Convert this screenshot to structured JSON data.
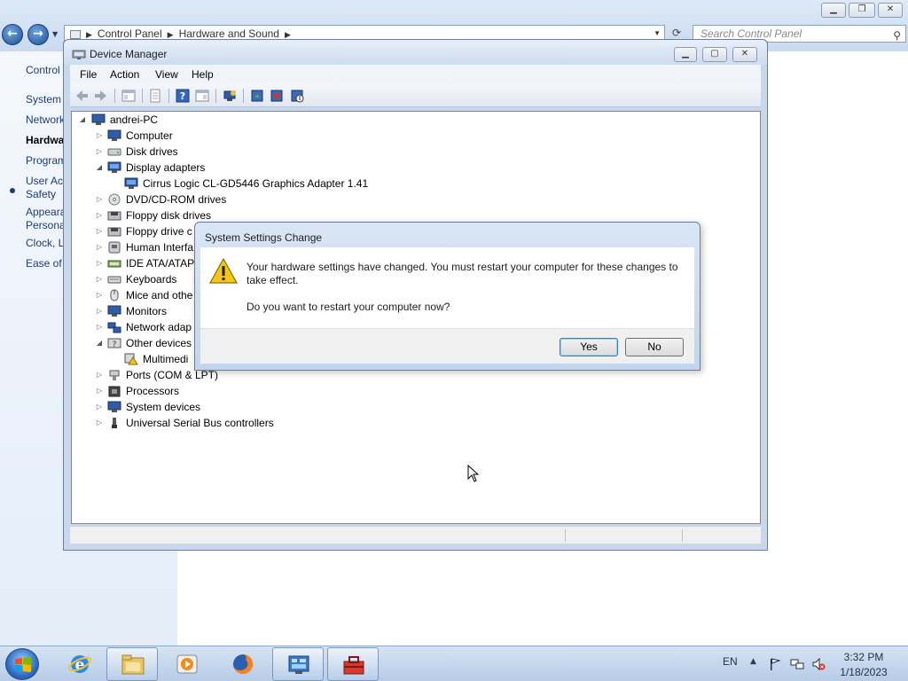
{
  "control_panel": {
    "breadcrumb": [
      "Control Panel",
      "Hardware and Sound"
    ],
    "search_placeholder": "Search Control Panel",
    "sidebar": [
      "Control",
      "System",
      "Network",
      "Hardwa",
      "Program",
      "User Ac",
      "Safety",
      "Appeara",
      "Persona",
      "Clock, L",
      "Ease of A"
    ]
  },
  "device_manager": {
    "title": "Device Manager",
    "menu": [
      "File",
      "Action",
      "View",
      "Help"
    ],
    "tree": {
      "root": "andrei-PC",
      "items": [
        "Computer",
        "Disk drives",
        "Display adapters",
        "Cirrus Logic CL-GD5446 Graphics Adapter 1.41",
        "DVD/CD-ROM drives",
        "Floppy disk drives",
        "Floppy drive c",
        "Human Interfa",
        "IDE ATA/ATAP",
        "Keyboards",
        "Mice and othe",
        "Monitors",
        "Network adap",
        "Other devices",
        "Multimedi",
        "Ports (COM & LPT)",
        "Processors",
        "System devices",
        "Universal Serial Bus controllers"
      ]
    }
  },
  "dialog": {
    "title": "System Settings Change",
    "message_line1": "Your hardware settings have changed. You must restart your computer for these changes to",
    "message_line2": "take effect.",
    "question": "Do you want to restart your computer now?",
    "yes_label": "Yes",
    "no_label": "No"
  },
  "taskbar": {
    "language": "EN",
    "time": "3:32 PM",
    "date": "1/18/2023"
  },
  "colors": {
    "link": "#1e3b73",
    "title_bar": "#cddcef",
    "accent_button": "#3c7fb1"
  }
}
